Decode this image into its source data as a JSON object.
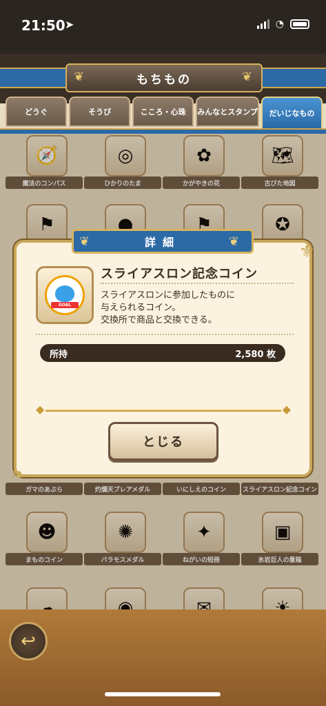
{
  "status_bar": {
    "time": "21:50"
  },
  "header": {
    "title": "もちもの"
  },
  "tabs": [
    {
      "label": "どうぐ"
    },
    {
      "label": "そうび"
    },
    {
      "label": "こころ・心珠"
    },
    {
      "label": "みんなとスタンプ"
    },
    {
      "label": "だいじなもの"
    }
  ],
  "grid_items": [
    {
      "label": "魔法のコンパス",
      "icon": "compass-icon"
    },
    {
      "label": "ひかりのたま",
      "icon": "orb-icon"
    },
    {
      "label": "かがやきの花",
      "icon": "flower-icon"
    },
    {
      "label": "古びた地図",
      "icon": "map-icon"
    },
    {
      "label": "ガマのあぶら",
      "icon": "oil-icon"
    },
    {
      "label": "灼爛天ブレアメダル",
      "icon": "medal-icon"
    },
    {
      "label": "いにしえのコイン",
      "icon": "coin-icon"
    },
    {
      "label": "スライアスロン記念コイン",
      "icon": "coin-icon"
    },
    {
      "label": "まものコイン",
      "icon": "coin-icon"
    },
    {
      "label": "バラモスメダル",
      "icon": "medal-icon"
    },
    {
      "label": "ねがいの短冊",
      "icon": "tanzaku-icon"
    },
    {
      "label": "氷岩巨人の重箱",
      "icon": "box-icon"
    }
  ],
  "dialog": {
    "header": "詳細",
    "item_name": "スライアスロン記念コイン",
    "coin_text": "GOAL",
    "description": [
      "スライアスロンに参加したものに",
      "与えられるコイン。",
      "交換所で商品と交換できる。"
    ],
    "owned_label": "所持",
    "owned_value": "2,580 枚",
    "close_label": "とじる"
  }
}
